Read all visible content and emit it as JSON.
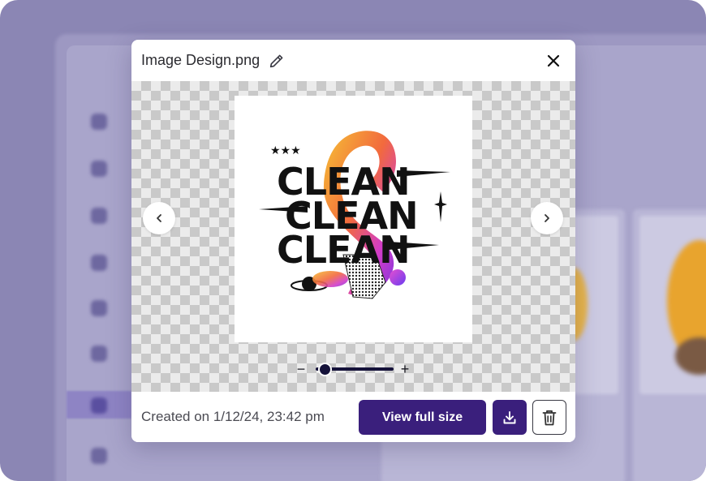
{
  "modal": {
    "file_name": "Image Design.png",
    "edit_icon": "pencil-icon",
    "close_icon": "close-icon",
    "artwork": {
      "lines": [
        "CLEAN",
        "CLEAN",
        "CLEAN"
      ]
    },
    "navigation": {
      "prev_icon": "chevron-left-icon",
      "next_icon": "chevron-right-icon"
    },
    "zoom": {
      "minus_label": "−",
      "plus_label": "+",
      "level": 0.12
    },
    "footer": {
      "created_label": "Created on 1/12/24, 23:42 pm",
      "view_full_size_label": "View full size",
      "download_icon": "download-icon",
      "delete_icon": "trash-icon"
    }
  },
  "colors": {
    "primary": "#3a1f7c",
    "slider": "#15123a",
    "backdrop": "#8b86b4"
  }
}
